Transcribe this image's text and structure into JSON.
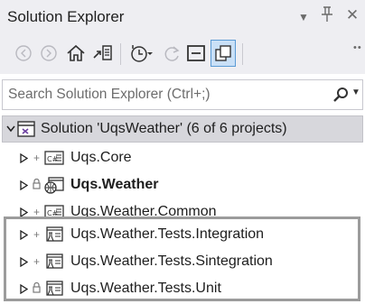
{
  "window": {
    "title": "Solution Explorer"
  },
  "toolbar": {
    "buttons": [
      "back-icon",
      "forward-icon",
      "home-icon",
      "switch-views-icon",
      "pending-changes-icon",
      "refresh-icon",
      "collapse-all-icon",
      "show-all-files-icon"
    ]
  },
  "search": {
    "placeholder": "Search Solution Explorer (Ctrl+;)"
  },
  "tree": {
    "solution": {
      "label": "Solution 'UqsWeather' (6 of 6 projects)"
    },
    "projects": [
      {
        "label": "Uqs.Core",
        "icon": "csharp-library-icon",
        "bold": false,
        "mark": "+"
      },
      {
        "label": "Uqs.Weather",
        "icon": "web-project-icon",
        "bold": true,
        "mark": "lock"
      },
      {
        "label": "Uqs.Weather.Common",
        "icon": "csharp-library-icon",
        "bold": false,
        "mark": "+"
      },
      {
        "label": "Uqs.Weather.Tests.Integration",
        "icon": "test-project-icon",
        "bold": false,
        "mark": "+"
      },
      {
        "label": "Uqs.Weather.Tests.Sintegration",
        "icon": "test-project-icon",
        "bold": false,
        "mark": "+"
      },
      {
        "label": "Uqs.Weather.Tests.Unit",
        "icon": "test-project-icon",
        "bold": false,
        "mark": "lock"
      }
    ]
  },
  "colors": {
    "panel_bg": "#eeeef2",
    "selection": "#d7d7dc",
    "highlight_border": "#9c9c9c"
  }
}
